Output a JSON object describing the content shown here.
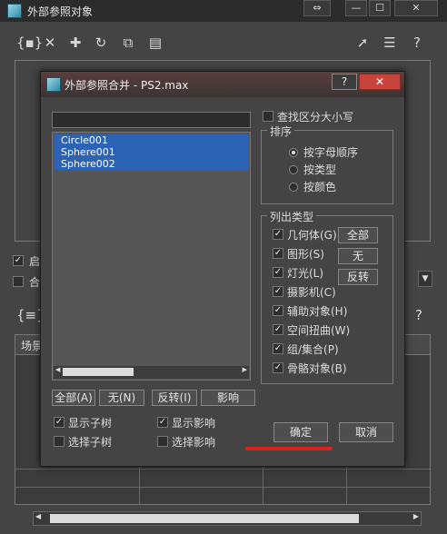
{
  "outer": {
    "title": "外部参照对象",
    "window_buttons": [
      "⇔",
      "—",
      "☐",
      "✕"
    ],
    "toolbar_icons": [
      "brace-icon",
      "close-icon",
      "plus-icon",
      "refresh-icon",
      "copy-icon",
      "paste-icon",
      "cursor-icon",
      "select-list-icon",
      "help-icon"
    ],
    "checkbox1_label": "启",
    "checkbox2_label": "合",
    "table_header_col1": "场景"
  },
  "dialog": {
    "title": "外部参照合并 - PS2.max",
    "help_button": "?",
    "close_button": "✕",
    "search_value": "",
    "list_items": [
      "Circle001",
      "Sphere001",
      "Sphere002"
    ],
    "buttons": {
      "all": "全部(A)",
      "none": "无(N)",
      "invert": "反转(I)",
      "influence": "影响",
      "ok": "确定",
      "cancel": "取消"
    },
    "options": {
      "show_subtree": "显示子树",
      "select_subtree": "选择子树",
      "show_influence": "显示影响",
      "select_influence": "选择影响",
      "show_subtree_checked": true,
      "select_subtree_checked": false,
      "show_influence_checked": true,
      "select_influence_checked": false
    },
    "case_sensitive": "查找区分大小写",
    "sort": {
      "title": "排序",
      "options": [
        "按字母顺序",
        "按类型",
        "按颜色"
      ],
      "selected_index": 0
    },
    "list_types": {
      "title": "列出类型",
      "items": [
        "几何体(G)",
        "图形(S)",
        "灯光(L)",
        "摄影机(C)",
        "辅助对象(H)",
        "空间扭曲(W)",
        "组/集合(P)",
        "骨骼对象(B)"
      ],
      "checked": [
        true,
        true,
        true,
        true,
        true,
        true,
        true,
        true
      ],
      "btn_all": "全部",
      "btn_none": "无",
      "btn_invert": "反转"
    }
  },
  "colors": {
    "selection": "#2d63b5",
    "close_button": "#c8433a",
    "annotation_underline": "#e0201a"
  }
}
